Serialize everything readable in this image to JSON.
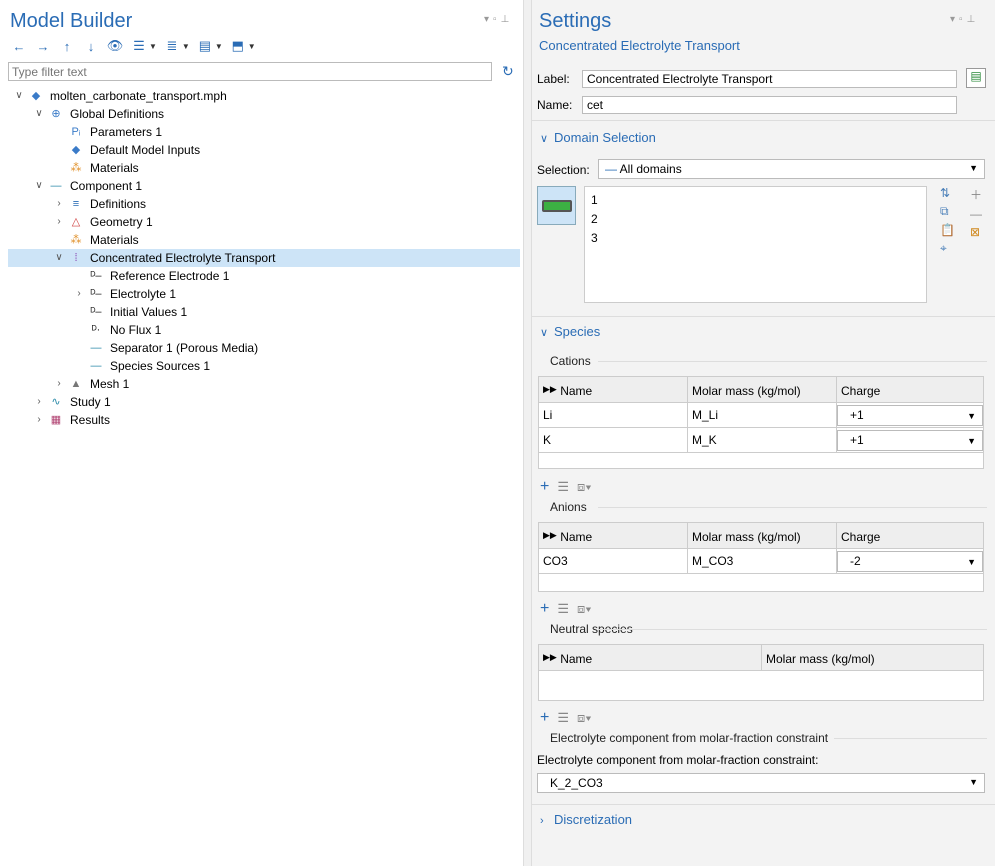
{
  "left": {
    "title": "Model Builder",
    "filter_placeholder": "Type filter text",
    "tree": [
      {
        "label": "molten_carbonate_transport.mph",
        "depth": 0,
        "arrow": "v",
        "icon": "model-file-icon"
      },
      {
        "label": "Global Definitions",
        "depth": 1,
        "arrow": "v",
        "icon": "globe-icon"
      },
      {
        "label": "Parameters 1",
        "depth": 2,
        "arrow": "",
        "icon": "parameters-icon"
      },
      {
        "label": "Default Model Inputs",
        "depth": 2,
        "arrow": "",
        "icon": "model-inputs-icon"
      },
      {
        "label": "Materials",
        "depth": 2,
        "arrow": "",
        "icon": "materials-icon"
      },
      {
        "label": "Component 1",
        "depth": 1,
        "arrow": "v",
        "icon": "component-icon"
      },
      {
        "label": "Definitions",
        "depth": 2,
        "arrow": ">",
        "icon": "definitions-icon"
      },
      {
        "label": "Geometry 1",
        "depth": 2,
        "arrow": ">",
        "icon": "geometry-icon"
      },
      {
        "label": "Materials",
        "depth": 2,
        "arrow": "",
        "icon": "materials-icon"
      },
      {
        "label": "Concentrated Electrolyte Transport",
        "depth": 2,
        "arrow": "v",
        "icon": "physics-icon",
        "selected": true
      },
      {
        "label": "Reference Electrode 1",
        "depth": 3,
        "arrow": "",
        "icon": "domain-feature-icon"
      },
      {
        "label": "Electrolyte 1",
        "depth": 3,
        "arrow": ">",
        "icon": "domain-feature-icon"
      },
      {
        "label": "Initial Values 1",
        "depth": 3,
        "arrow": "",
        "icon": "domain-feature-icon"
      },
      {
        "label": "No Flux 1",
        "depth": 3,
        "arrow": "",
        "icon": "boundary-feature-icon"
      },
      {
        "label": "Separator 1 (Porous Media)",
        "depth": 3,
        "arrow": "",
        "icon": "line-icon"
      },
      {
        "label": "Species Sources 1",
        "depth": 3,
        "arrow": "",
        "icon": "line-icon"
      },
      {
        "label": "Mesh 1",
        "depth": 2,
        "arrow": ">",
        "icon": "mesh-icon"
      },
      {
        "label": "Study 1",
        "depth": 1,
        "arrow": ">",
        "icon": "study-icon"
      },
      {
        "label": "Results",
        "depth": 1,
        "arrow": ">",
        "icon": "results-icon"
      }
    ]
  },
  "right": {
    "title": "Settings",
    "subtitle": "Concentrated Electrolyte Transport",
    "label_caption": "Label:",
    "label_value": "Concentrated Electrolyte Transport",
    "name_caption": "Name:",
    "name_value": "cet",
    "domain_section": "Domain Selection",
    "selection_caption": "Selection:",
    "selection_value": "All domains",
    "domains": [
      "1",
      "2",
      "3"
    ],
    "species_section": "Species",
    "cations_group": "Cations",
    "anions_group": "Anions",
    "neutral_group": "Neutral species",
    "col_name": "Name",
    "col_molar": "Molar mass (kg/mol)",
    "col_charge": "Charge",
    "cations": [
      {
        "name": "Li",
        "molar": "M_Li",
        "charge": "+1"
      },
      {
        "name": "K",
        "molar": "M_K",
        "charge": "+1"
      }
    ],
    "anions": [
      {
        "name": "CO3",
        "molar": "M_CO3",
        "charge": "-2"
      }
    ],
    "constraint_group": "Electrolyte component from molar-fraction constraint",
    "constraint_caption": "Electrolyte component from molar-fraction constraint:",
    "constraint_value": "K_2_CO3",
    "discretization_section": "Discretization"
  }
}
